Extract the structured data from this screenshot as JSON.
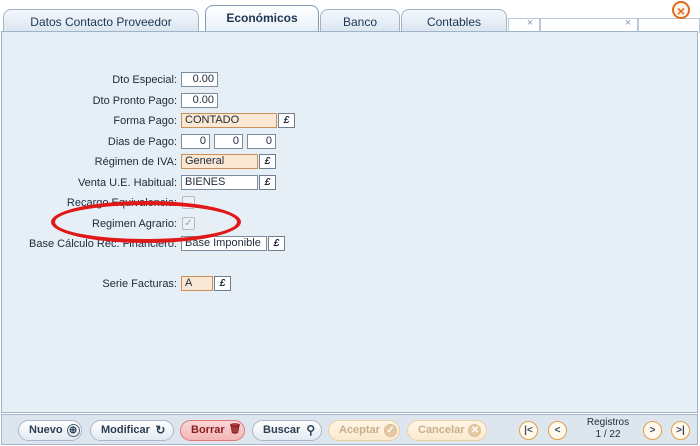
{
  "tabs": [
    {
      "label": "Datos Contacto Proveedor"
    },
    {
      "label": "Económicos"
    },
    {
      "label": "Banco"
    },
    {
      "label": "Contables"
    }
  ],
  "tab_close_glyph": "×",
  "close_glyph": "×",
  "form": {
    "dto_especial": {
      "label": "Dto Especial:",
      "value": "0.00"
    },
    "dto_pronto_pago": {
      "label": "Dto Pronto Pago:",
      "value": "0.00"
    },
    "forma_pago": {
      "label": "Forma Pago:",
      "value": "CONTADO"
    },
    "dias_pago": {
      "label": "Dias de Pago:",
      "values": [
        "0",
        "0",
        "0"
      ]
    },
    "regimen_iva": {
      "label": "Régimen de IVA:",
      "value": "General"
    },
    "venta_ue": {
      "label": "Venta U.E. Habitual:",
      "value": "BIENES"
    },
    "recargo_equivalencia": {
      "label": "Recargo Equivalencia:"
    },
    "regimen_agrario": {
      "label": "Regimen Agrario:",
      "checked": true
    },
    "base_calculo": {
      "label": "Base Cálculo Rec. Financiero:",
      "value": "Base Imponible"
    },
    "serie_facturas": {
      "label": "Serie Facturas:",
      "value": "A"
    }
  },
  "picker_glyph": "£",
  "toolbar": {
    "nuevo": {
      "label": "Nuevo",
      "icon": "⊕"
    },
    "modificar": {
      "label": "Modificar",
      "icon": "↻"
    },
    "borrar": {
      "label": "Borrar",
      "icon": "🗑"
    },
    "buscar": {
      "label": "Buscar",
      "icon": "⚲"
    },
    "aceptar": {
      "label": "Aceptar",
      "icon": "✓"
    },
    "cancelar": {
      "label": "Cancelar",
      "icon": "✕"
    }
  },
  "nav": {
    "first": "|<",
    "prev": "<",
    "next": ">",
    "last": ">|"
  },
  "registros": {
    "label": "Registros",
    "position": "1 / 22"
  },
  "colors": {
    "highlight_ellipse": "#e01818",
    "disabled_field_bg": "#fbe8d4"
  }
}
